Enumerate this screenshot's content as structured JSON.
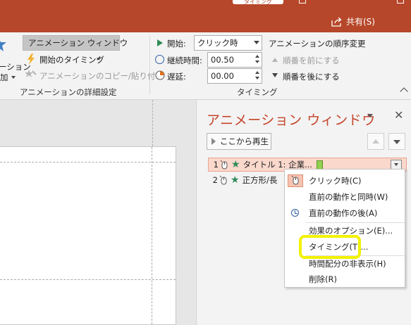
{
  "titlebar": {
    "tab_fragment": "タイミング",
    "share_label": "共有(S)"
  },
  "ribbon": {
    "left_partial_1": "ーション",
    "left_partial_2": "加",
    "anim_window_label": "アニメーション ウィンドウ",
    "trigger_label": "開始のタイミング",
    "anim_painter_label": "アニメーションのコピー/貼り付け",
    "advanced_group_label": "アニメーションの詳細設定",
    "start_label": "開始:",
    "start_value": "クリック時",
    "duration_label": "継続時間:",
    "duration_value": "00.50",
    "delay_label": "遅延:",
    "delay_value": "00.00",
    "timing_group_label": "タイミング",
    "reorder_title": "アニメーションの順序変更",
    "move_earlier_label": "順番を前にする",
    "move_later_label": "順番を後にする"
  },
  "pane": {
    "title": "アニメーション ウィンドウ",
    "play_label": "ここから再生",
    "close_glyph": "✕",
    "items": [
      {
        "num": "1",
        "label": "タイトル 1: 企業..."
      },
      {
        "num": "2",
        "label": "正方形/長"
      }
    ]
  },
  "menu": {
    "items": [
      {
        "label": "クリック時(C)"
      },
      {
        "label": "直前の動作と同時(W)"
      },
      {
        "label": "直前の動作の後(A)"
      },
      {
        "label": "効果のオプション(E)..."
      },
      {
        "label": "タイミング(T)..."
      },
      {
        "label": "時間配分の非表示(H)"
      },
      {
        "label": "削除(R)"
      }
    ]
  },
  "colors": {
    "accent": "#b7472a",
    "pane_title": "#c4442a",
    "highlight": "#f2f200",
    "star": "#2e8b57"
  },
  "icons": [
    "share-icon",
    "star-icon",
    "alarm-clock-icon",
    "lightning-icon",
    "painter-icon",
    "play-icon",
    "clock-icon",
    "hourglass-icon",
    "mouse-icon",
    "close-icon",
    "chevron-down-icon"
  ]
}
